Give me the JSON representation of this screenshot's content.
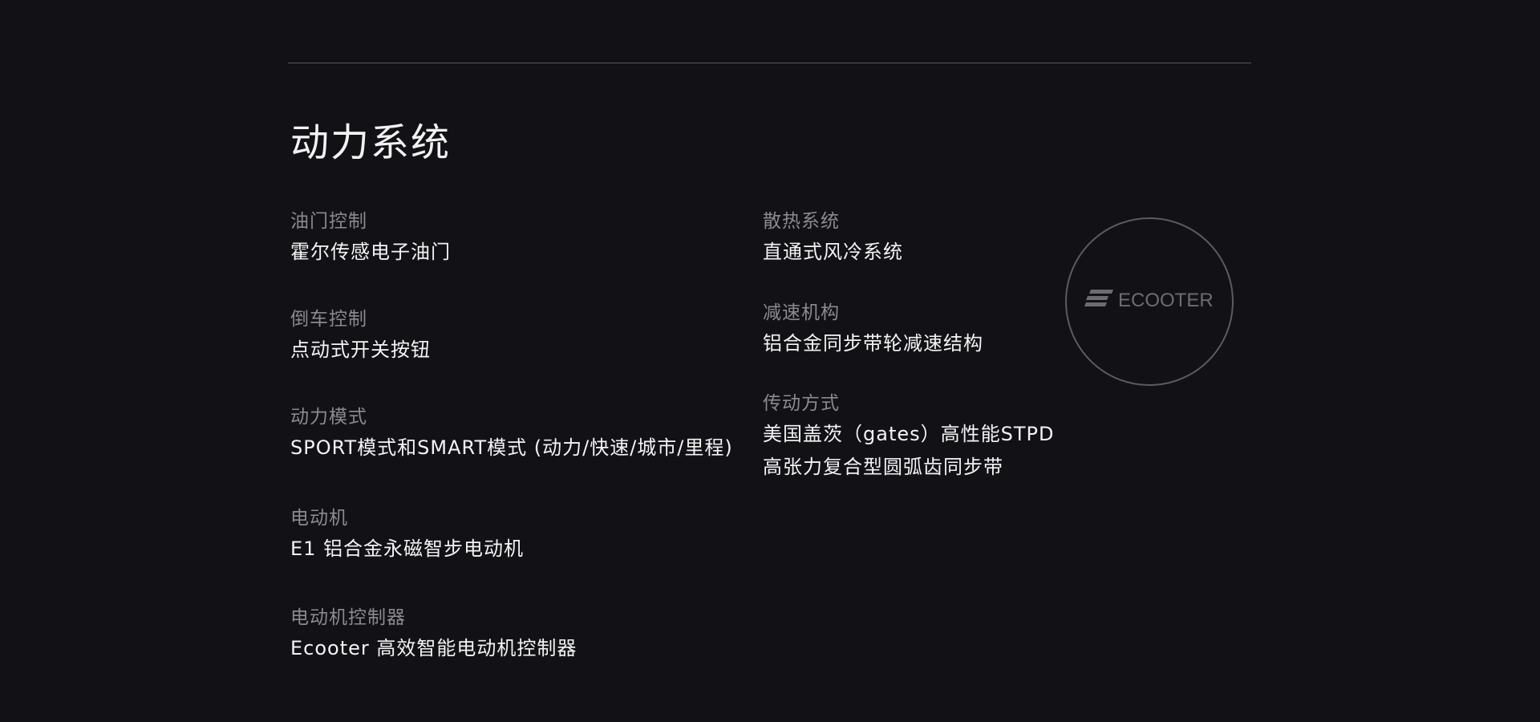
{
  "section": {
    "title": "动力系统"
  },
  "left_specs": [
    {
      "label": "油门控制",
      "value": "霍尔传感电子油门"
    },
    {
      "label": "倒车控制",
      "value": "点动式开关按钮"
    },
    {
      "label": "动力模式",
      "value": "SPORT模式和SMART模式 (动力/快速/城市/里程)"
    },
    {
      "label": "电动机",
      "value": "E1 铝合金永磁智步电动机"
    },
    {
      "label": "电动机控制器",
      "value": "Ecooter 高效智能电动机控制器"
    }
  ],
  "right_specs": [
    {
      "label": "散热系统",
      "values": [
        "直通式风冷系统"
      ]
    },
    {
      "label": "减速机构",
      "values": [
        "铝合金同步带轮减速结构"
      ]
    },
    {
      "label": "传动方式",
      "values": [
        "美国盖茨（gates）高性能STPD",
        "高张力复合型圆弧齿同步带"
      ]
    }
  ],
  "logo": {
    "text": "ECOOTER",
    "icon": "ecooter-logo-icon"
  },
  "colors": {
    "background": "#121116",
    "label": "#8b8a90",
    "value": "#f4f4f4",
    "rule": "#5a5960",
    "logo": "#6d6c72"
  }
}
